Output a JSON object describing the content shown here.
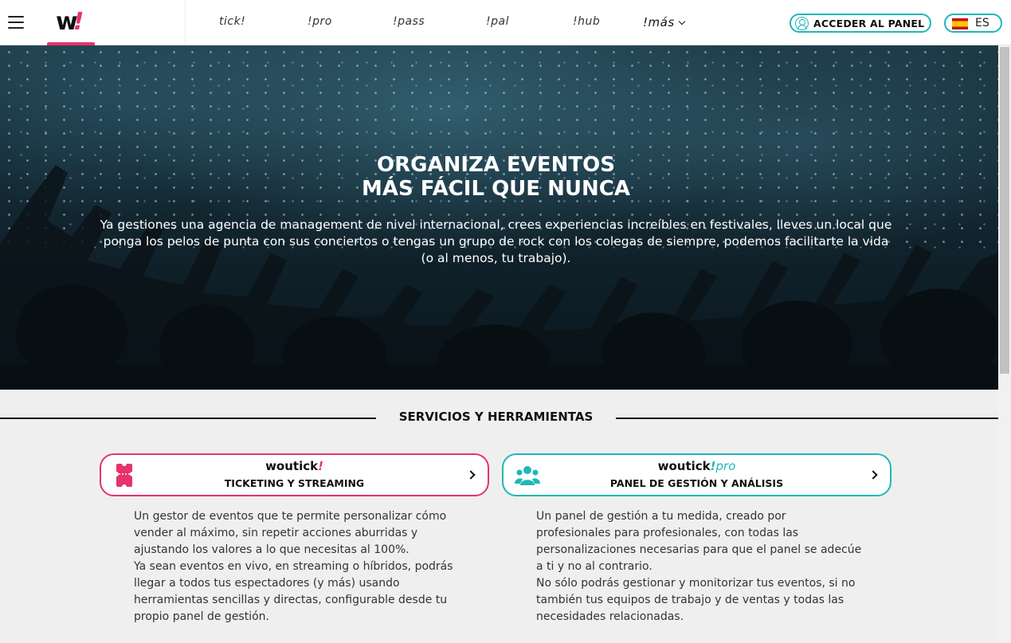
{
  "header": {
    "logo_text": "w",
    "logo_bang": "!",
    "nav": [
      {
        "label": "tick!"
      },
      {
        "label": "!pro"
      },
      {
        "label": "!pass"
      },
      {
        "label": "!pal"
      },
      {
        "label": "!hub"
      },
      {
        "label": "!más"
      }
    ],
    "panel_button": "ACCEDER AL PANEL",
    "language": "ES",
    "accent_pink": "#e6336b",
    "accent_teal": "#1fb7b7"
  },
  "hero": {
    "title_line1": "ORGANIZA EVENTOS",
    "title_line2": "MÁS FÁCIL QUE NUNCA",
    "text": "Ya gestiones una agencia de management de nivel internacional, crees experiencias increíbles en festivales, lleves un local que ponga los pelos de punta con sus conciertos o tengas un grupo de rock con los colegas de siempre, podemos facilitarte la vida (o al menos, tu trabajo)."
  },
  "services": {
    "title": "SERVICIOS Y HERRAMIENTAS",
    "cards": [
      {
        "brand": "woutick",
        "bang": "!",
        "suffix": "",
        "subtitle": "TICKETING Y STREAMING",
        "icon": "ticket-icon",
        "description": [
          "Un gestor de eventos que te permite personalizar cómo vender al máximo, sin repetir acciones aburridas y ajustando los valores a lo que necesitas al 100%.",
          "Ya sean eventos en vivo, en streaming o híbridos, podrás llegar a todos tus espectadores (y más) usando herramientas sencillas y directas, configurable desde tu propio panel de gestión."
        ]
      },
      {
        "brand": "woutick",
        "bang": "!",
        "suffix": "pro",
        "subtitle": "PANEL DE GESTIÓN Y ANÁLISIS",
        "icon": "group-icon",
        "description": [
          "Un panel de gestión a tu medida, creado por profesionales para profesionales, con todas las personalizaciones necesarias para que el panel se adecúe a ti y no al contrario.",
          "No sólo podrás gestionar y monitorizar tus eventos, si no también tus equipos de trabajo y de ventas y todas las necesidades relacionadas."
        ]
      }
    ]
  }
}
